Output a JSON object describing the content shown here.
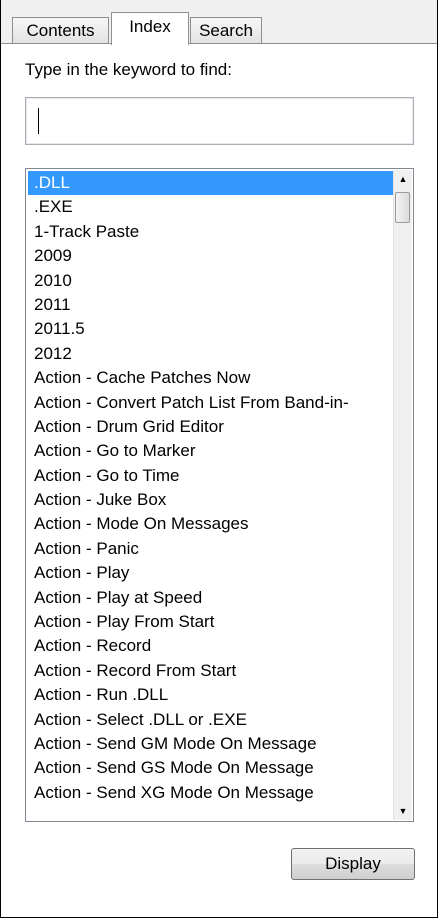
{
  "tabs": [
    {
      "label": "Contents",
      "active": false
    },
    {
      "label": "Index",
      "active": true
    },
    {
      "label": "Search",
      "active": false
    }
  ],
  "keyword": {
    "label": "Type in the keyword to find:",
    "value": ""
  },
  "index_list": {
    "selected": ".DLL",
    "items": [
      ".DLL",
      ".EXE",
      "1-Track Paste",
      "2009",
      "2010",
      "2011",
      "2011.5",
      "2012",
      "Action - Cache Patches Now",
      "Action - Convert Patch List From Band-in-",
      "Action - Drum Grid Editor",
      "Action - Go to Marker",
      "Action - Go to Time",
      "Action - Juke Box",
      "Action - Mode On Messages",
      "Action - Panic",
      "Action - Play",
      "Action - Play at Speed",
      "Action - Play From Start",
      "Action - Record",
      "Action - Record From Start",
      "Action - Run .DLL",
      "Action - Select .DLL or .EXE",
      "Action - Send GM Mode On Message",
      "Action - Send GS Mode On Message",
      "Action - Send XG Mode On Message"
    ]
  },
  "buttons": {
    "display": "Display"
  },
  "colors": {
    "selection": "#3399ff",
    "panel": "#ffffff",
    "chrome": "#f0f0f0"
  }
}
